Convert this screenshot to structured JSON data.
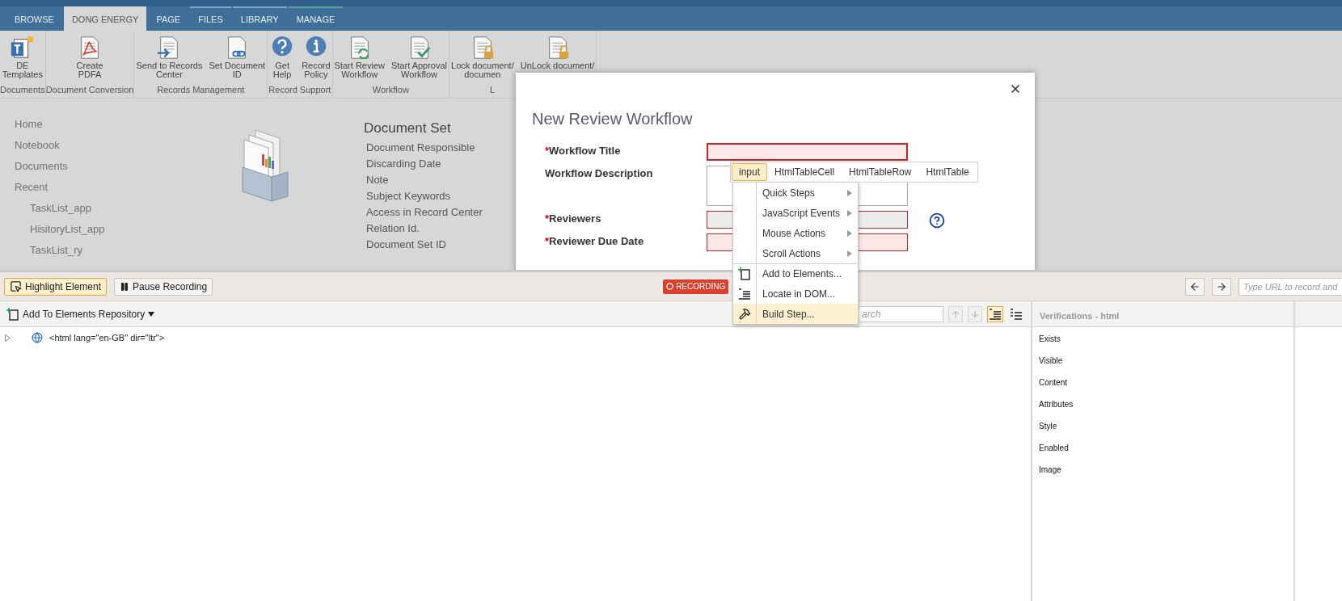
{
  "ribbon_tabs": [
    {
      "label": "BROWSE",
      "selected": false
    },
    {
      "label": "DONG ENERGY",
      "selected": true
    },
    {
      "label": "PAGE",
      "selected": false
    },
    {
      "label": "FILES",
      "selected": false,
      "color": "#7ea6d6"
    },
    {
      "label": "LIBRARY",
      "selected": false,
      "color": "#7ea6d6"
    },
    {
      "label": "MANAGE",
      "selected": false,
      "color": "#5fa39a"
    }
  ],
  "ribbon_groups": [
    {
      "label": "Documents",
      "buttons": [
        {
          "kind": "templates",
          "lines": [
            "DE",
            "Templates"
          ]
        }
      ]
    },
    {
      "label": "Document Conversion",
      "buttons": [
        {
          "kind": "pdf",
          "lines": [
            "Create",
            "PDFA"
          ]
        }
      ]
    },
    {
      "label": "Records Management",
      "buttons": [
        {
          "kind": "send",
          "lines": [
            "Send to Records",
            "Center"
          ]
        },
        {
          "kind": "docid",
          "lines": [
            "Set Document",
            "ID"
          ]
        }
      ]
    },
    {
      "label": "Record Support",
      "buttons": [
        {
          "kind": "help",
          "lines": [
            "Get",
            "Help"
          ]
        },
        {
          "kind": "info",
          "lines": [
            "Record",
            "Policy"
          ]
        }
      ]
    },
    {
      "label": "Workflow",
      "buttons": [
        {
          "kind": "review",
          "lines": [
            "Start Review",
            "Workflow"
          ]
        },
        {
          "kind": "approval",
          "lines": [
            "Start Approval",
            "Workflow"
          ]
        }
      ]
    },
    {
      "label": "L",
      "buttons": [
        {
          "kind": "lock",
          "lines": [
            "Lock document/",
            "documen"
          ]
        },
        {
          "kind": "unlock",
          "lines": [
            "UnLock document/"
          ]
        }
      ]
    }
  ],
  "nav": [
    {
      "label": "Home"
    },
    {
      "label": "Notebook"
    },
    {
      "label": "Documents"
    },
    {
      "label": "Recent",
      "children": [
        {
          "label": "TaskList_app"
        },
        {
          "label": "HisitoryList_app"
        },
        {
          "label": "TaskList_ry"
        }
      ]
    }
  ],
  "document_set": {
    "title": "Document Set",
    "fields": [
      "Document Responsible",
      "Discarding Date",
      "Note",
      "Subject Keywords",
      "Access in Record Center",
      "Relation Id.",
      "Document Set ID"
    ]
  },
  "dialog": {
    "title": "New Review Workflow",
    "fields": [
      {
        "mark": "*",
        "label": "Workflow Title",
        "kind": "text",
        "invalid": true,
        "focused": true
      },
      {
        "label": "Workflow Description",
        "kind": "textarea",
        "invalid": false
      },
      {
        "mark": "*",
        "label": "Reviewers",
        "kind": "people",
        "invalid": true,
        "help": true
      },
      {
        "mark": "*",
        "label": "Reviewer Due Date",
        "kind": "text",
        "invalid": true
      }
    ]
  },
  "element_chips": [
    {
      "label": "input",
      "selected": true
    },
    {
      "label": "HtmlTableCell",
      "selected": false
    },
    {
      "label": "HtmlTableRow",
      "selected": false
    },
    {
      "label": "HtmlTable",
      "selected": false
    }
  ],
  "context_menu": [
    {
      "label": "Quick Steps",
      "kind": "submenu",
      "selected": false
    },
    {
      "label": "JavaScript Events",
      "kind": "submenu",
      "selected": false
    },
    {
      "label": "Mouse Actions",
      "kind": "submenu",
      "selected": false
    },
    {
      "label": "Scroll Actions",
      "kind": "submenu",
      "selected": false
    },
    {
      "label": "Add to Elements...",
      "kind": "add",
      "selected": false
    },
    {
      "label": "Locate in DOM...",
      "kind": "locate",
      "selected": false
    },
    {
      "label": "Build Step...",
      "kind": "build",
      "selected": true
    }
  ],
  "toolbar": {
    "buttons": [
      {
        "label": "Highlight Element",
        "kind": "highlight",
        "selected": true
      },
      {
        "label": "Pause Recording",
        "kind": "pause",
        "selected": false
      }
    ],
    "status": "RECORDING",
    "url_placeholder": "Type URL to record and"
  },
  "repository_button": "Add To Elements Repository",
  "search": {
    "placeholder": "arch"
  },
  "view_toggles": [
    {
      "kind": "tree",
      "selected": true
    },
    {
      "kind": "list",
      "selected": false
    }
  ],
  "dom_tree": [
    {
      "label": "<html lang=\"en-GB\" dir=\"ltr\">",
      "expanded": false
    }
  ],
  "verifications": {
    "title": "Verifications - html",
    "items": [
      "Exists",
      "Visible",
      "Content",
      "Attributes",
      "Style",
      "Enabled",
      "Image"
    ]
  }
}
